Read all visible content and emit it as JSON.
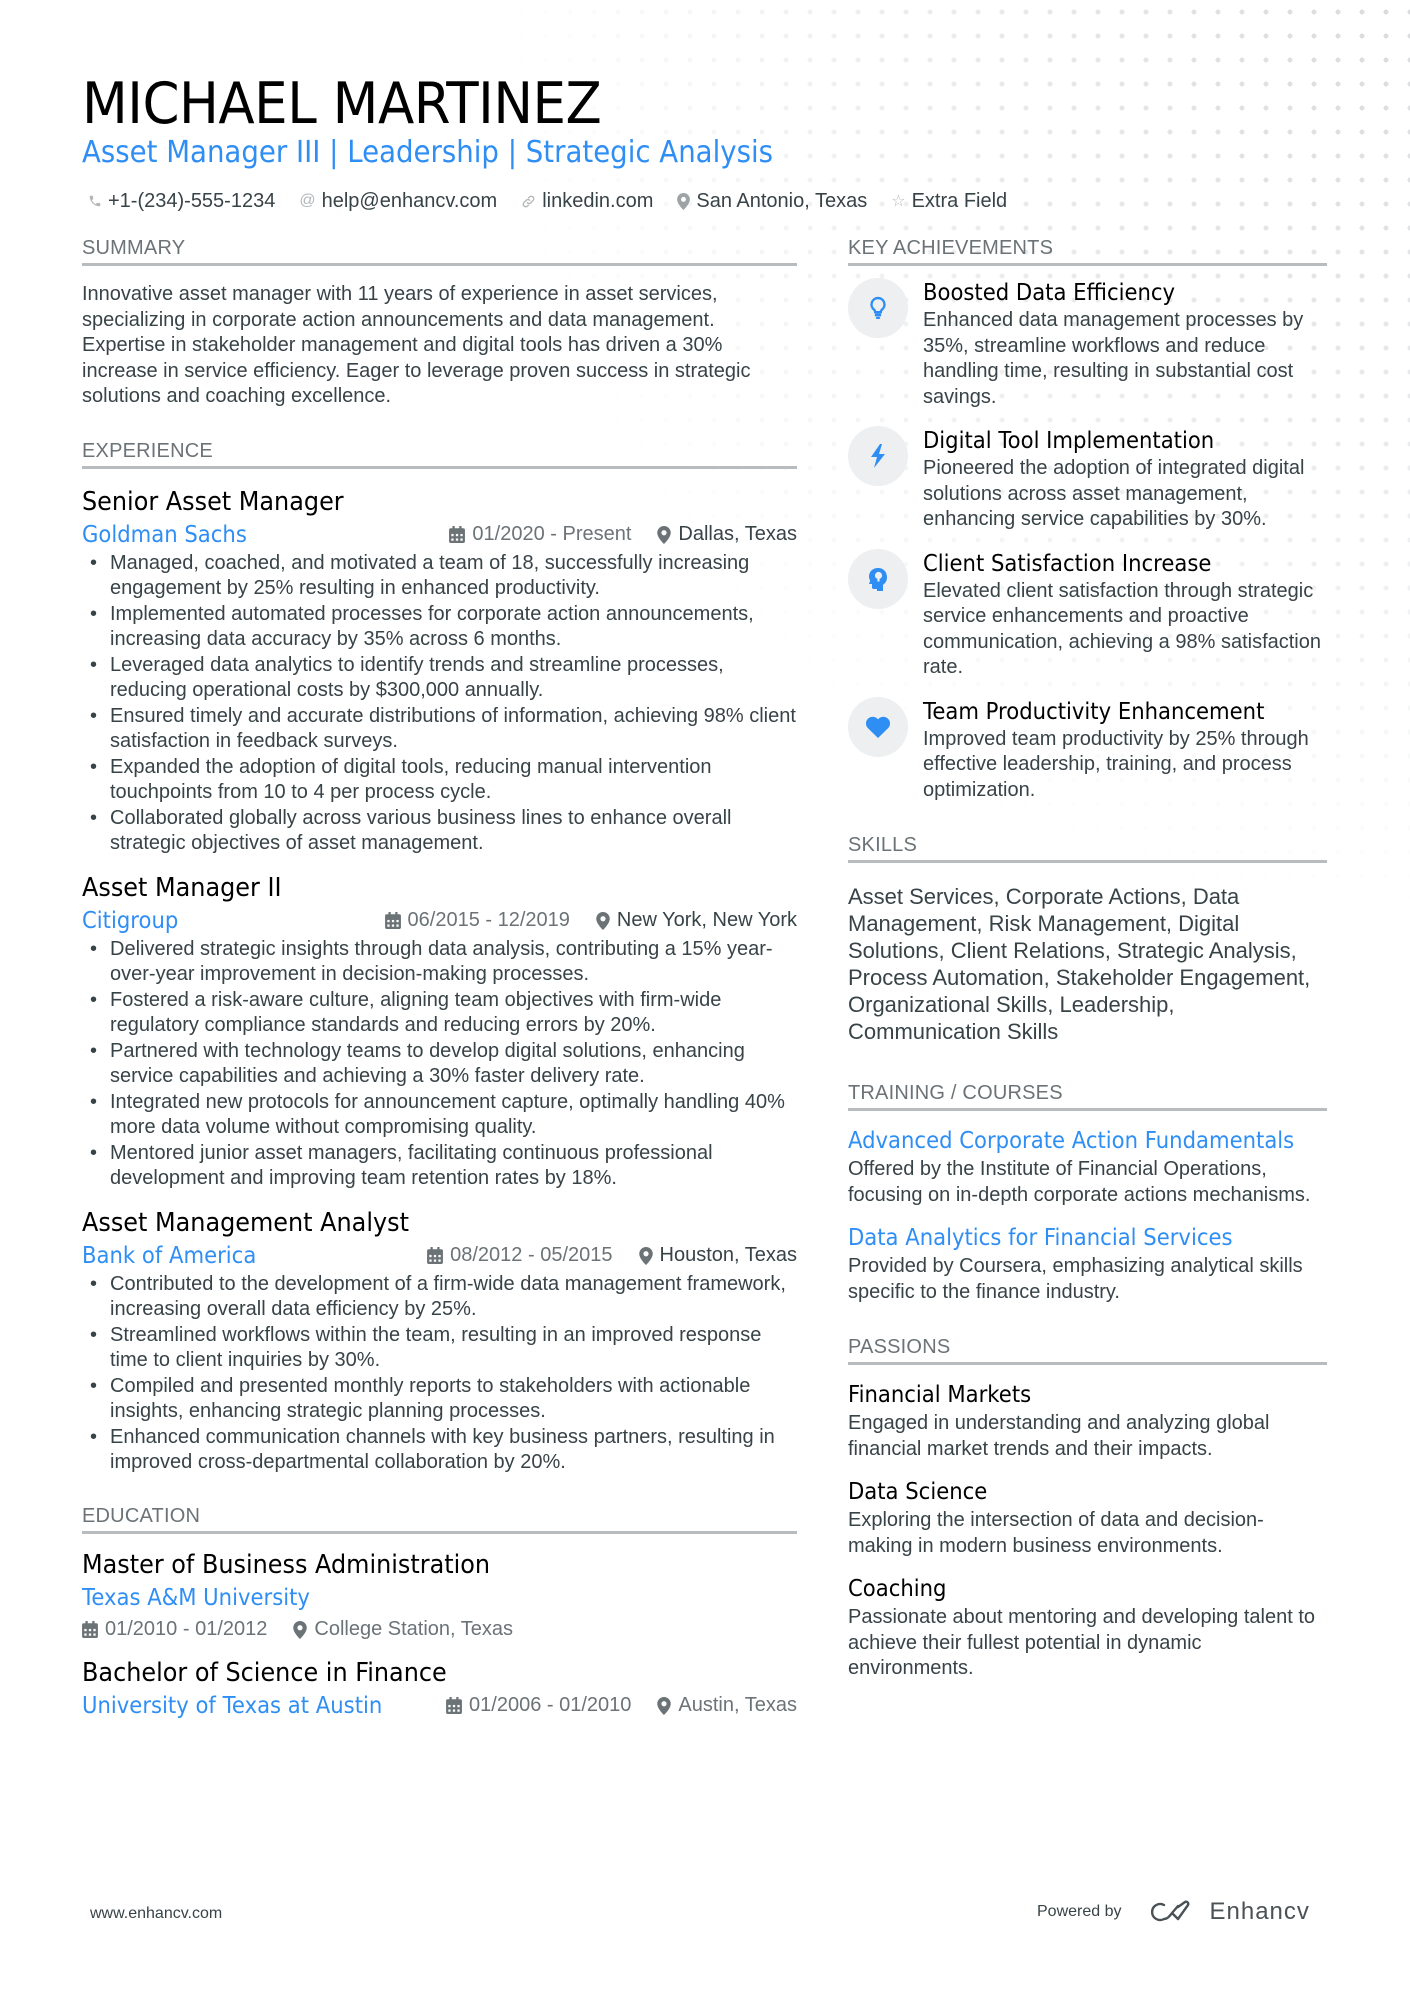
{
  "header": {
    "name": "MICHAEL MARTINEZ",
    "headline": "Asset Manager III | Leadership | Strategic Analysis",
    "contacts": [
      {
        "icon": "phone-icon",
        "text": "+1-(234)-555-1234"
      },
      {
        "icon": "at-icon",
        "text": "help@enhancv.com"
      },
      {
        "icon": "link-icon",
        "text": "linkedin.com"
      },
      {
        "icon": "location-pin-icon",
        "text": "San Antonio, Texas"
      },
      {
        "icon": "star-icon",
        "text": "Extra Field"
      }
    ]
  },
  "summary": {
    "heading": "SUMMARY",
    "text": "Innovative asset manager with 11 years of experience in asset services, specializing in corporate action announcements and data management. Expertise in stakeholder management and digital tools has driven a 30% increase in service efficiency. Eager to leverage proven success in strategic solutions and coaching excellence."
  },
  "experience": {
    "heading": "EXPERIENCE",
    "jobs": [
      {
        "title": "Senior Asset Manager",
        "company": "Goldman Sachs",
        "dates": "01/2020 - Present",
        "location": "Dallas, Texas",
        "bullets": [
          "Managed, coached, and motivated a team of 18, successfully increasing engagement by 25% resulting in enhanced productivity.",
          "Implemented automated processes for corporate action announcements, increasing data accuracy by 35% across 6 months.",
          "Leveraged data analytics to identify trends and streamline processes, reducing operational costs by $300,000 annually.",
          "Ensured timely and accurate distributions of information, achieving 98% client satisfaction in feedback surveys.",
          "Expanded the adoption of digital tools, reducing manual intervention touchpoints from 10 to 4 per process cycle.",
          "Collaborated globally across various business lines to enhance overall strategic objectives of asset management."
        ]
      },
      {
        "title": "Asset Manager II",
        "company": "Citigroup",
        "dates": "06/2015 - 12/2019",
        "location": "New York, New York",
        "bullets": [
          "Delivered strategic insights through data analysis, contributing a 15% year-over-year improvement in decision-making processes.",
          "Fostered a risk-aware culture, aligning team objectives with firm-wide regulatory compliance standards and reducing errors by 20%.",
          "Partnered with technology teams to develop digital solutions, enhancing service capabilities and achieving a 30% faster delivery rate.",
          "Integrated new protocols for announcement capture, optimally handling 40% more data volume without compromising quality.",
          "Mentored junior asset managers, facilitating continuous professional development and improving team retention rates by 18%."
        ]
      },
      {
        "title": "Asset Management Analyst",
        "company": "Bank of America",
        "dates": "08/2012 - 05/2015",
        "location": "Houston, Texas",
        "bullets": [
          "Contributed to the development of a firm-wide data management framework, increasing overall data efficiency by 25%.",
          "Streamlined workflows within the team, resulting in an improved response time to client inquiries by 30%.",
          "Compiled and presented monthly reports to stakeholders with actionable insights, enhancing strategic planning processes.",
          "Enhanced communication channels with key business partners, resulting in improved cross-departmental collaboration by 20%."
        ]
      }
    ]
  },
  "education": {
    "heading": "EDUCATION",
    "items": [
      {
        "degree": "Master of Business Administration",
        "school": "Texas A&M University",
        "dates": "01/2010 - 01/2012",
        "location": "College Station, Texas"
      },
      {
        "degree": "Bachelor of Science in Finance",
        "school": "University of Texas at Austin",
        "dates": "01/2006 - 01/2010",
        "location": "Austin, Texas"
      }
    ]
  },
  "achievements": {
    "heading": "KEY ACHIEVEMENTS",
    "items": [
      {
        "icon": "lightbulb-icon",
        "title": "Boosted Data Efficiency",
        "desc": "Enhanced data management processes by 35%, streamline workflows and reduce handling time, resulting in substantial cost savings."
      },
      {
        "icon": "lightning-bolt-icon",
        "title": "Digital Tool Implementation",
        "desc": "Pioneered the adoption of integrated digital solutions across asset management, enhancing service capabilities by 30%."
      },
      {
        "icon": "head-idea-icon",
        "title": "Client Satisfaction Increase",
        "desc": "Elevated client satisfaction through strategic service enhancements and proactive communication, achieving a 98% satisfaction rate."
      },
      {
        "icon": "heart-icon",
        "title": "Team Productivity Enhancement",
        "desc": "Improved team productivity by 25% through effective leadership, training, and process optimization."
      }
    ]
  },
  "skills": {
    "heading": "SKILLS",
    "text": "Asset Services, Corporate Actions, Data Management, Risk Management, Digital Solutions, Client Relations, Strategic Analysis, Process Automation, Stakeholder Engagement, Organizational Skills, Leadership, Communication Skills"
  },
  "training": {
    "heading": "TRAINING / COURSES",
    "items": [
      {
        "title": "Advanced Corporate Action Fundamentals",
        "desc": "Offered by the Institute of Financial Operations, focusing on in-depth corporate actions mechanisms."
      },
      {
        "title": "Data Analytics for Financial Services",
        "desc": "Provided by Coursera, emphasizing analytical skills specific to the finance industry."
      }
    ]
  },
  "passions": {
    "heading": "PASSIONS",
    "items": [
      {
        "title": "Financial Markets",
        "desc": "Engaged in understanding and analyzing global financial market trends and their impacts."
      },
      {
        "title": "Data Science",
        "desc": "Exploring the intersection of data and decision-making in modern business environments."
      },
      {
        "title": "Coaching",
        "desc": "Passionate about mentoring and developing talent to achieve their fullest potential in dynamic environments."
      }
    ]
  },
  "footer": {
    "website": "www.enhancv.com",
    "powered_by": "Powered by",
    "brand": "Enhancv"
  },
  "colors": {
    "accent": "#2f8ef4",
    "text": "#384347",
    "heading_rule": "#b9bcbe",
    "icon_circle": "#eeeff0"
  }
}
